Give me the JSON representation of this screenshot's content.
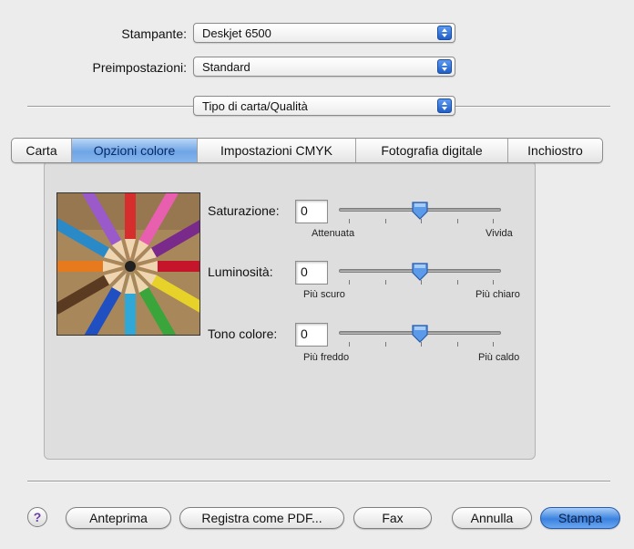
{
  "printer": {
    "label": "Stampante:",
    "value": "Deskjet 6500"
  },
  "presets": {
    "label": "Preimpostazioni:",
    "value": "Standard"
  },
  "panel_menu": {
    "value": "Tipo di carta/Qualità"
  },
  "tabs": [
    {
      "label": "Carta",
      "active": false
    },
    {
      "label": "Opzioni colore",
      "active": true
    },
    {
      "label": "Impostazioni CMYK",
      "active": false
    },
    {
      "label": "Fotografia digitale",
      "active": false
    },
    {
      "label": "Inchiostro",
      "active": false
    }
  ],
  "controls": {
    "saturation": {
      "label": "Saturazione:",
      "value": "0",
      "min_label": "Attenuata",
      "max_label": "Vivida",
      "level": 0.5
    },
    "brightness": {
      "label": "Luminosità:",
      "value": "0",
      "min_label": "Più scuro",
      "max_label": "Più chiaro",
      "level": 0.5
    },
    "tone": {
      "label": "Tono colore:",
      "value": "0",
      "min_label": "Più freddo",
      "max_label": "Più caldo",
      "level": 0.5
    }
  },
  "buttons": {
    "preview": "Anteprima",
    "save_pdf": "Registra come PDF...",
    "fax": "Fax",
    "cancel": "Annulla",
    "print": "Stampa"
  },
  "help_icon": "help-icon",
  "colors": {
    "accent": "#3b82e0",
    "window_bg": "#ececec"
  }
}
